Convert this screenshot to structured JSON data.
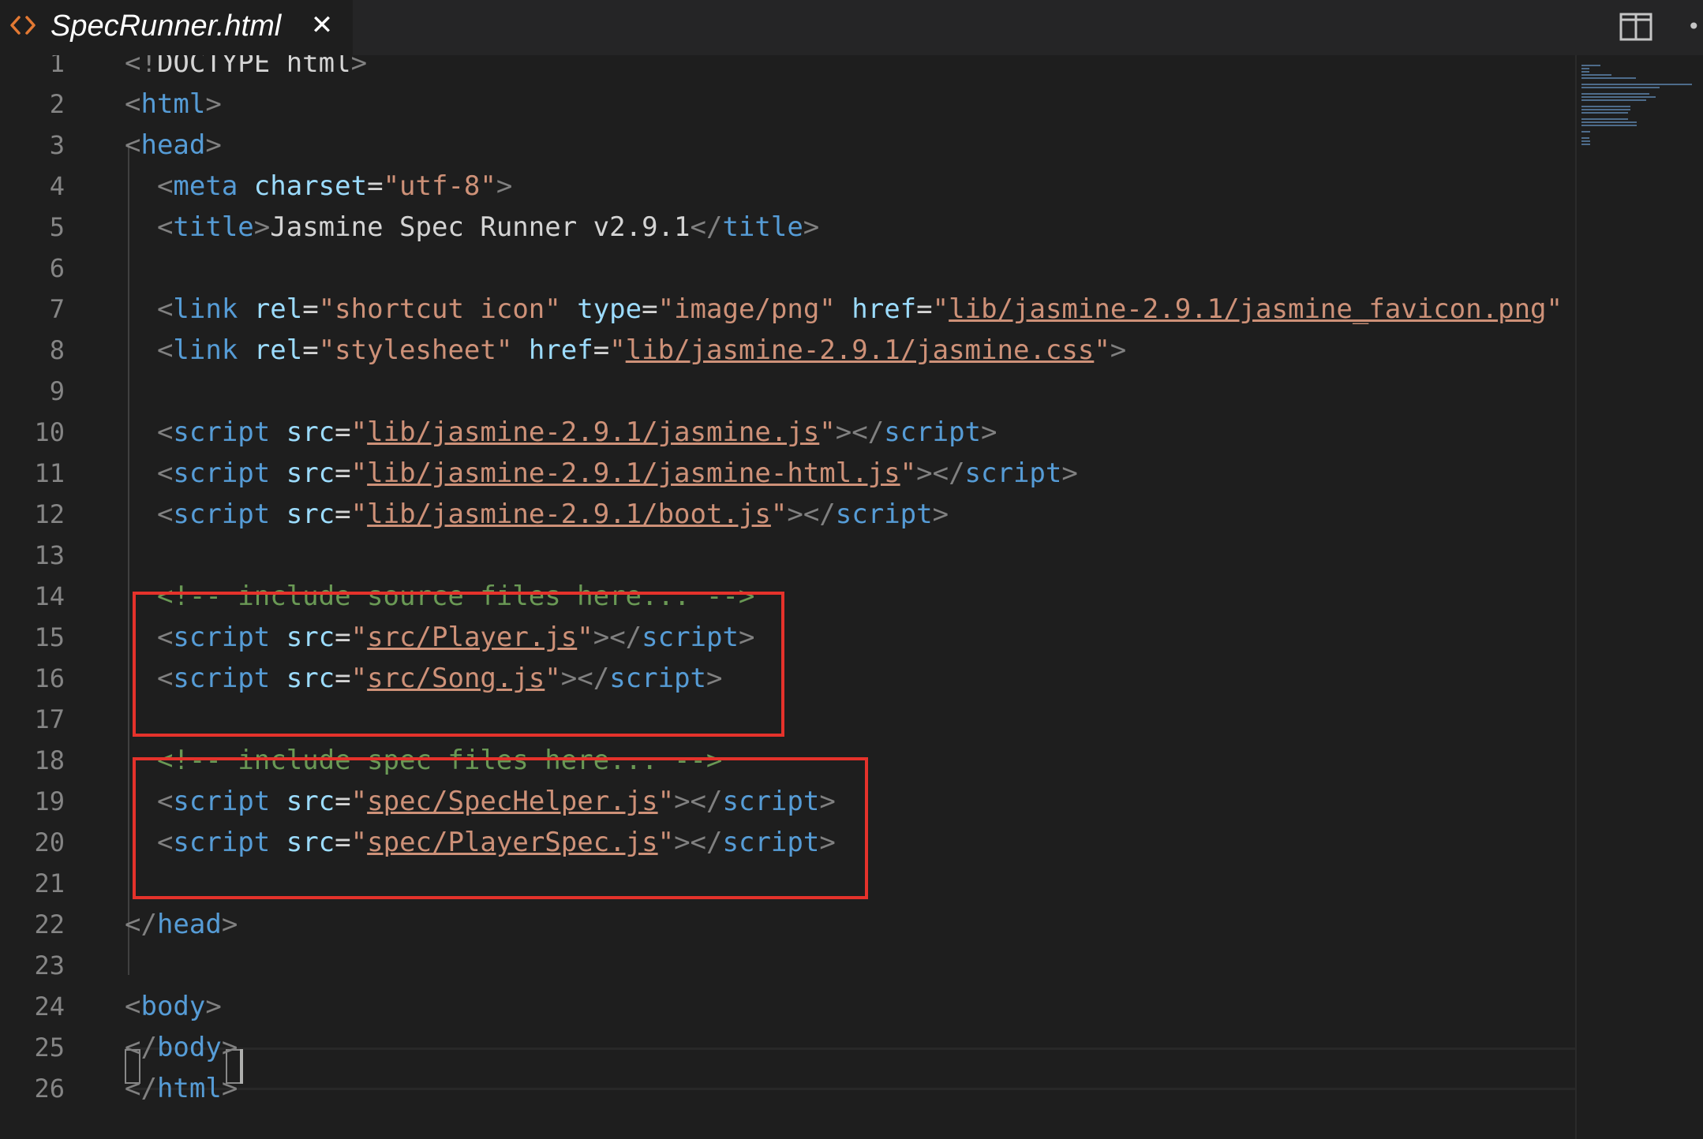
{
  "tab": {
    "title": "SpecRunner.html",
    "file_icon": "html-brackets-icon",
    "close_icon": "close-icon",
    "close_glyph": "✕"
  },
  "toolbar": {
    "split_icon": "split-editor-icon",
    "more_icon": "more-actions-icon",
    "more_glyph": "•"
  },
  "colors": {
    "tag": "#569cd6",
    "attribute": "#9cdcfe",
    "string": "#ce9178",
    "comment": "#6a9955",
    "highlight_box": "#e5322b",
    "tab_icon": "#e37933"
  },
  "editor": {
    "lines": [
      [
        {
          "t": "<!",
          "c": "tag-bracket"
        },
        {
          "t": "DOCTYPE html",
          "c": "plain"
        },
        {
          "t": ">",
          "c": "tag-bracket"
        }
      ],
      [
        {
          "t": "<",
          "c": "tag-bracket"
        },
        {
          "t": "html",
          "c": "tag"
        },
        {
          "t": ">",
          "c": "tag-bracket"
        }
      ],
      [
        {
          "t": "<",
          "c": "tag-bracket"
        },
        {
          "t": "head",
          "c": "tag"
        },
        {
          "t": ">",
          "c": "tag-bracket"
        }
      ],
      [
        {
          "t": "  <",
          "c": "tag-bracket"
        },
        {
          "t": "meta",
          "c": "tag"
        },
        {
          "t": " ",
          "c": "plain"
        },
        {
          "t": "charset",
          "c": "attr"
        },
        {
          "t": "=",
          "c": "plain"
        },
        {
          "t": "\"utf-8\"",
          "c": "str"
        },
        {
          "t": ">",
          "c": "tag-bracket"
        }
      ],
      [
        {
          "t": "  <",
          "c": "tag-bracket"
        },
        {
          "t": "title",
          "c": "tag"
        },
        {
          "t": ">",
          "c": "tag-bracket"
        },
        {
          "t": "Jasmine Spec Runner v2.9.1",
          "c": "plain"
        },
        {
          "t": "</",
          "c": "tag-bracket"
        },
        {
          "t": "title",
          "c": "tag"
        },
        {
          "t": ">",
          "c": "tag-bracket"
        }
      ],
      [],
      [
        {
          "t": "  <",
          "c": "tag-bracket"
        },
        {
          "t": "link",
          "c": "tag"
        },
        {
          "t": " ",
          "c": "plain"
        },
        {
          "t": "rel",
          "c": "attr"
        },
        {
          "t": "=",
          "c": "plain"
        },
        {
          "t": "\"shortcut icon\"",
          "c": "str"
        },
        {
          "t": " ",
          "c": "plain"
        },
        {
          "t": "type",
          "c": "attr"
        },
        {
          "t": "=",
          "c": "plain"
        },
        {
          "t": "\"image/png\"",
          "c": "str"
        },
        {
          "t": " ",
          "c": "plain"
        },
        {
          "t": "href",
          "c": "attr"
        },
        {
          "t": "=",
          "c": "plain"
        },
        {
          "t": "\"",
          "c": "str"
        },
        {
          "t": "lib/jasmine-2.9.1/jasmine_favicon.png",
          "c": "link"
        },
        {
          "t": "\"",
          "c": "str"
        }
      ],
      [
        {
          "t": "  <",
          "c": "tag-bracket"
        },
        {
          "t": "link",
          "c": "tag"
        },
        {
          "t": " ",
          "c": "plain"
        },
        {
          "t": "rel",
          "c": "attr"
        },
        {
          "t": "=",
          "c": "plain"
        },
        {
          "t": "\"stylesheet\"",
          "c": "str"
        },
        {
          "t": " ",
          "c": "plain"
        },
        {
          "t": "href",
          "c": "attr"
        },
        {
          "t": "=",
          "c": "plain"
        },
        {
          "t": "\"",
          "c": "str"
        },
        {
          "t": "lib/jasmine-2.9.1/jasmine.css",
          "c": "link"
        },
        {
          "t": "\"",
          "c": "str"
        },
        {
          "t": ">",
          "c": "tag-bracket"
        }
      ],
      [],
      [
        {
          "t": "  <",
          "c": "tag-bracket"
        },
        {
          "t": "script",
          "c": "tag"
        },
        {
          "t": " ",
          "c": "plain"
        },
        {
          "t": "src",
          "c": "attr"
        },
        {
          "t": "=",
          "c": "plain"
        },
        {
          "t": "\"",
          "c": "str"
        },
        {
          "t": "lib/jasmine-2.9.1/jasmine.js",
          "c": "link"
        },
        {
          "t": "\"",
          "c": "str"
        },
        {
          "t": "></",
          "c": "tag-bracket"
        },
        {
          "t": "script",
          "c": "tag"
        },
        {
          "t": ">",
          "c": "tag-bracket"
        }
      ],
      [
        {
          "t": "  <",
          "c": "tag-bracket"
        },
        {
          "t": "script",
          "c": "tag"
        },
        {
          "t": " ",
          "c": "plain"
        },
        {
          "t": "src",
          "c": "attr"
        },
        {
          "t": "=",
          "c": "plain"
        },
        {
          "t": "\"",
          "c": "str"
        },
        {
          "t": "lib/jasmine-2.9.1/jasmine-html.js",
          "c": "link"
        },
        {
          "t": "\"",
          "c": "str"
        },
        {
          "t": "></",
          "c": "tag-bracket"
        },
        {
          "t": "script",
          "c": "tag"
        },
        {
          "t": ">",
          "c": "tag-bracket"
        }
      ],
      [
        {
          "t": "  <",
          "c": "tag-bracket"
        },
        {
          "t": "script",
          "c": "tag"
        },
        {
          "t": " ",
          "c": "plain"
        },
        {
          "t": "src",
          "c": "attr"
        },
        {
          "t": "=",
          "c": "plain"
        },
        {
          "t": "\"",
          "c": "str"
        },
        {
          "t": "lib/jasmine-2.9.1/boot.js",
          "c": "link"
        },
        {
          "t": "\"",
          "c": "str"
        },
        {
          "t": "></",
          "c": "tag-bracket"
        },
        {
          "t": "script",
          "c": "tag"
        },
        {
          "t": ">",
          "c": "tag-bracket"
        }
      ],
      [],
      [
        {
          "t": "  <!-- include source files here... -->",
          "c": "cmt"
        }
      ],
      [
        {
          "t": "  <",
          "c": "tag-bracket"
        },
        {
          "t": "script",
          "c": "tag"
        },
        {
          "t": " ",
          "c": "plain"
        },
        {
          "t": "src",
          "c": "attr"
        },
        {
          "t": "=",
          "c": "plain"
        },
        {
          "t": "\"",
          "c": "str"
        },
        {
          "t": "src/Player.js",
          "c": "link"
        },
        {
          "t": "\"",
          "c": "str"
        },
        {
          "t": "></",
          "c": "tag-bracket"
        },
        {
          "t": "script",
          "c": "tag"
        },
        {
          "t": ">",
          "c": "tag-bracket"
        }
      ],
      [
        {
          "t": "  <",
          "c": "tag-bracket"
        },
        {
          "t": "script",
          "c": "tag"
        },
        {
          "t": " ",
          "c": "plain"
        },
        {
          "t": "src",
          "c": "attr"
        },
        {
          "t": "=",
          "c": "plain"
        },
        {
          "t": "\"",
          "c": "str"
        },
        {
          "t": "src/Song.js",
          "c": "link"
        },
        {
          "t": "\"",
          "c": "str"
        },
        {
          "t": "></",
          "c": "tag-bracket"
        },
        {
          "t": "script",
          "c": "tag"
        },
        {
          "t": ">",
          "c": "tag-bracket"
        }
      ],
      [],
      [
        {
          "t": "  <!-- include spec files here... -->",
          "c": "cmt"
        }
      ],
      [
        {
          "t": "  <",
          "c": "tag-bracket"
        },
        {
          "t": "script",
          "c": "tag"
        },
        {
          "t": " ",
          "c": "plain"
        },
        {
          "t": "src",
          "c": "attr"
        },
        {
          "t": "=",
          "c": "plain"
        },
        {
          "t": "\"",
          "c": "str"
        },
        {
          "t": "spec/SpecHelper.js",
          "c": "link"
        },
        {
          "t": "\"",
          "c": "str"
        },
        {
          "t": "></",
          "c": "tag-bracket"
        },
        {
          "t": "script",
          "c": "tag"
        },
        {
          "t": ">",
          "c": "tag-bracket"
        }
      ],
      [
        {
          "t": "  <",
          "c": "tag-bracket"
        },
        {
          "t": "script",
          "c": "tag"
        },
        {
          "t": " ",
          "c": "plain"
        },
        {
          "t": "src",
          "c": "attr"
        },
        {
          "t": "=",
          "c": "plain"
        },
        {
          "t": "\"",
          "c": "str"
        },
        {
          "t": "spec/PlayerSpec.js",
          "c": "link"
        },
        {
          "t": "\"",
          "c": "str"
        },
        {
          "t": "></",
          "c": "tag-bracket"
        },
        {
          "t": "script",
          "c": "tag"
        },
        {
          "t": ">",
          "c": "tag-bracket"
        }
      ],
      [],
      [
        {
          "t": "</",
          "c": "tag-bracket"
        },
        {
          "t": "head",
          "c": "tag"
        },
        {
          "t": ">",
          "c": "tag-bracket"
        }
      ],
      [],
      [
        {
          "t": "<",
          "c": "tag-bracket"
        },
        {
          "t": "body",
          "c": "tag"
        },
        {
          "t": ">",
          "c": "tag-bracket"
        }
      ],
      [
        {
          "t": "</",
          "c": "tag-bracket"
        },
        {
          "t": "body",
          "c": "tag"
        },
        {
          "t": ">",
          "c": "tag-bracket"
        }
      ],
      [
        {
          "t": "</",
          "c": "tag-bracket"
        },
        {
          "t": "html",
          "c": "tag"
        },
        {
          "t": ">",
          "c": "tag-bracket"
        }
      ]
    ]
  }
}
